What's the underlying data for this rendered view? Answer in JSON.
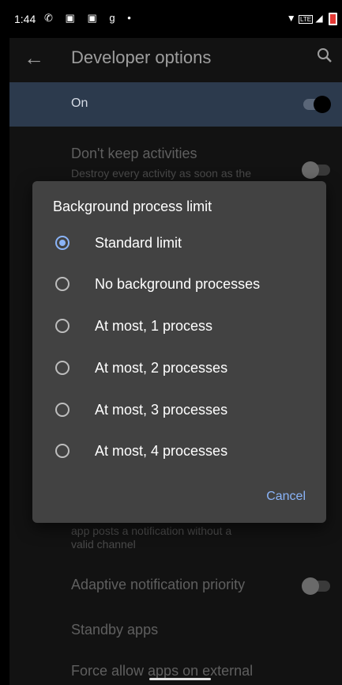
{
  "status_bar": {
    "time": "1:44",
    "left_icons": [
      "whatsapp-icon",
      "photo-icon",
      "photo-icon",
      "g-icon",
      "dot-icon"
    ],
    "right_icons": [
      "wifi-icon",
      "volte-icon",
      "signal-icon",
      "battery-icon"
    ],
    "lte_label": "LTE"
  },
  "app_bar": {
    "title": "Developer options",
    "back_icon": "arrow-back-icon",
    "search_icon": "search-icon"
  },
  "main_switch": {
    "label": "On",
    "state": true
  },
  "background_settings": {
    "dont_keep_title": "Don't keep activities",
    "dont_keep_subtitle": "Destroy every activity as soon as the",
    "notif_subtitle_line1": "app posts a notification without a",
    "notif_subtitle_line2": "valid channel",
    "adaptive_title": "Adaptive notification priority",
    "standby_title": "Standby apps",
    "force_allow_title": "Force allow apps on external"
  },
  "dialog": {
    "title": "Background process limit",
    "options": [
      {
        "label": "Standard limit",
        "selected": true
      },
      {
        "label": "No background processes",
        "selected": false
      },
      {
        "label": "At most, 1 process",
        "selected": false
      },
      {
        "label": "At most, 2 processes",
        "selected": false
      },
      {
        "label": "At most, 3 processes",
        "selected": false
      },
      {
        "label": "At most, 4 processes",
        "selected": false
      }
    ],
    "cancel_label": "Cancel"
  },
  "colors": {
    "accent": "#8ab4f8",
    "dialog_bg": "#424242",
    "screen_bg": "#121212",
    "main_switch_bg": "#2c3a4d"
  }
}
